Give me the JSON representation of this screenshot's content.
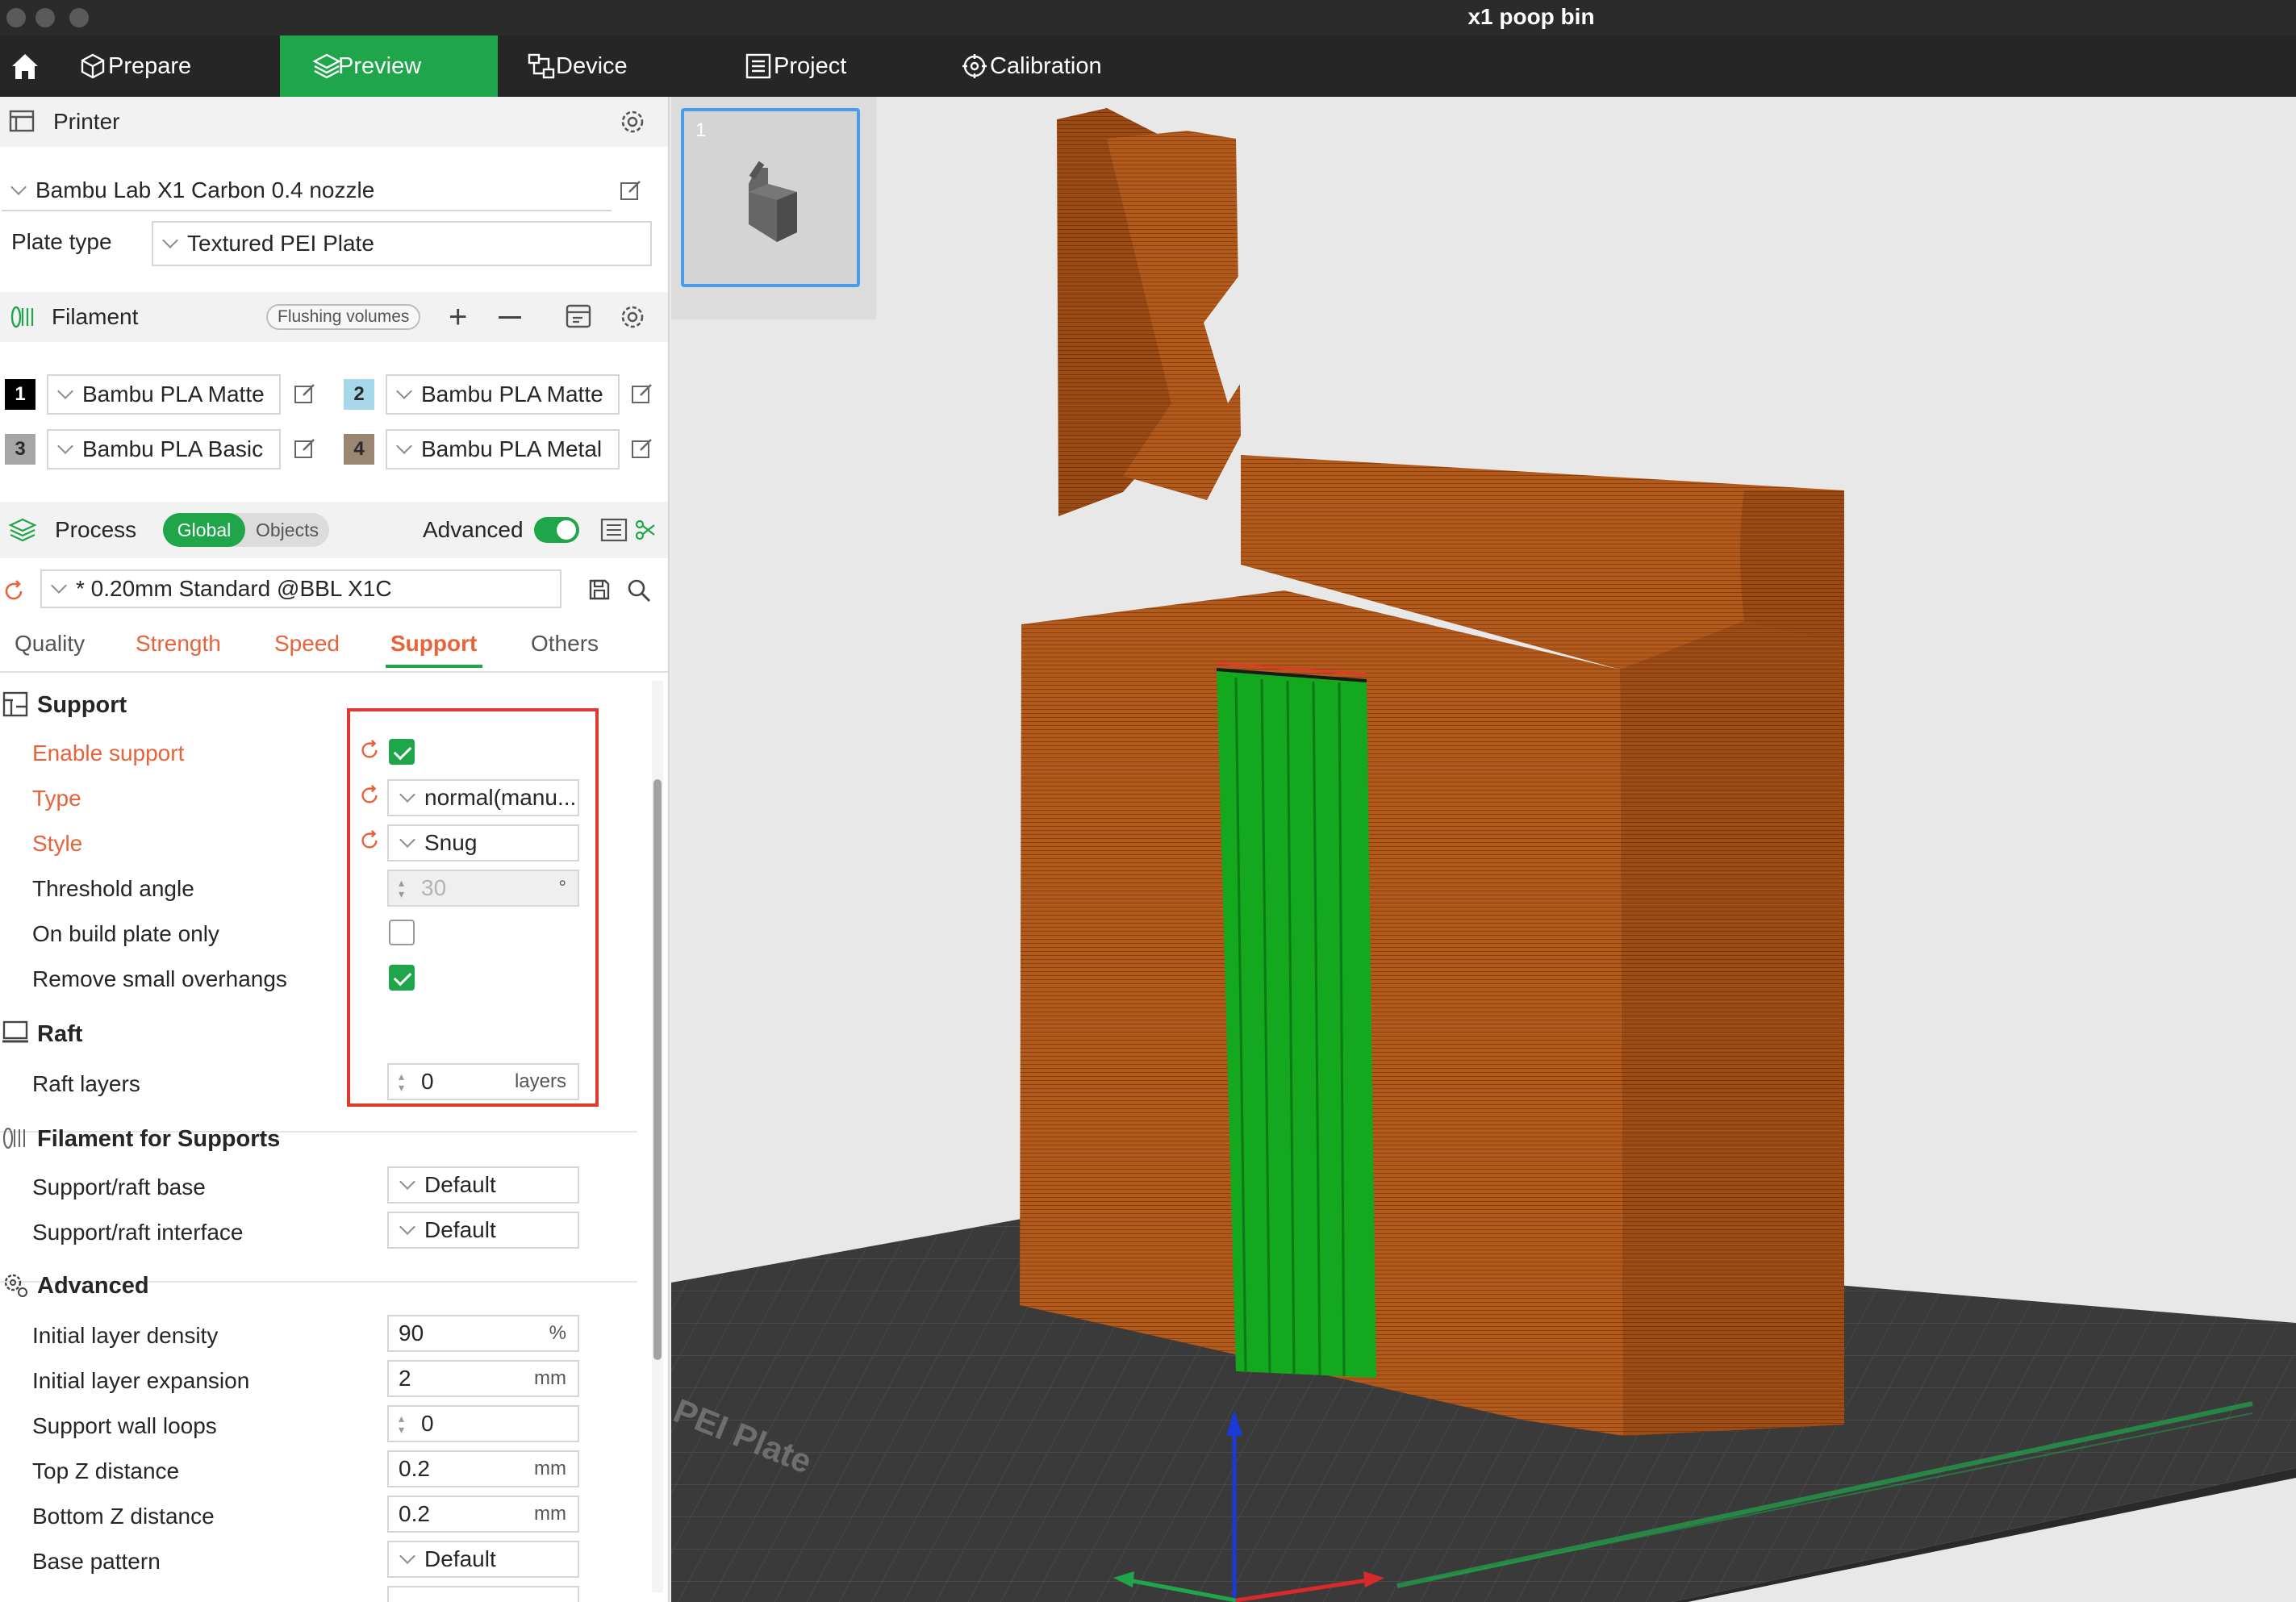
{
  "window": {
    "title": "x1 poop bin"
  },
  "nav": {
    "tabs": [
      {
        "label": "Prepare"
      },
      {
        "label": "Preview"
      },
      {
        "label": "Device"
      },
      {
        "label": "Project"
      },
      {
        "label": "Calibration"
      }
    ],
    "active_tab": "Preview"
  },
  "printer": {
    "title": "Printer",
    "model": "Bambu Lab X1 Carbon 0.4 nozzle",
    "plate_type_label": "Plate type",
    "plate_type": "Textured PEI Plate"
  },
  "filament": {
    "title": "Filament",
    "flushing_label": "Flushing volumes",
    "slots": [
      {
        "num": "1",
        "name": "Bambu PLA Matte",
        "color": "#000000"
      },
      {
        "num": "2",
        "name": "Bambu PLA Matte",
        "color": "#a7d8ea"
      },
      {
        "num": "3",
        "name": "Bambu PLA Basic",
        "color": "#a6a6a6"
      },
      {
        "num": "4",
        "name": "Bambu PLA Metal",
        "color": "#9b8674"
      }
    ]
  },
  "process": {
    "title": "Process",
    "scope_global": "Global",
    "scope_objects": "Objects",
    "advanced_label": "Advanced",
    "advanced_enabled": true,
    "preset": "* 0.20mm Standard @BBL X1C",
    "tabs": [
      "Quality",
      "Strength",
      "Speed",
      "Support",
      "Others"
    ],
    "active_tab": "Support"
  },
  "support": {
    "title": "Support",
    "enable_support": {
      "label": "Enable support",
      "checked": true
    },
    "type": {
      "label": "Type",
      "value": "normal(manu..."
    },
    "style": {
      "label": "Style",
      "value": "Snug"
    },
    "threshold_angle": {
      "label": "Threshold angle",
      "value": "30",
      "unit": "°"
    },
    "on_build_plate_only": {
      "label": "On build plate only",
      "checked": false
    },
    "remove_small_overhangs": {
      "label": "Remove small overhangs",
      "checked": true
    }
  },
  "raft": {
    "title": "Raft",
    "raft_layers": {
      "label": "Raft layers",
      "value": "0",
      "unit": "layers"
    }
  },
  "filament_supports": {
    "title": "Filament for Supports",
    "base": {
      "label": "Support/raft base",
      "value": "Default"
    },
    "interface": {
      "label": "Support/raft interface",
      "value": "Default"
    }
  },
  "advanced": {
    "title": "Advanced",
    "initial_layer_density": {
      "label": "Initial layer density",
      "value": "90",
      "unit": "%"
    },
    "initial_layer_expansion": {
      "label": "Initial layer expansion",
      "value": "2",
      "unit": "mm"
    },
    "support_wall_loops": {
      "label": "Support wall loops",
      "value": "0"
    },
    "top_z_distance": {
      "label": "Top Z distance",
      "value": "0.2",
      "unit": "mm"
    },
    "bottom_z_distance": {
      "label": "Bottom Z distance",
      "value": "0.2",
      "unit": "mm"
    },
    "base_pattern": {
      "label": "Base pattern",
      "value": "Default"
    }
  },
  "viewport": {
    "plate_number": "1",
    "plate_name": "PEI Plate",
    "colors": {
      "model": "#b25a1c",
      "support": "#14a81e",
      "plate": "#3a3a3a",
      "accent": "#1fa64a",
      "highlight": "#e23a2a"
    }
  }
}
